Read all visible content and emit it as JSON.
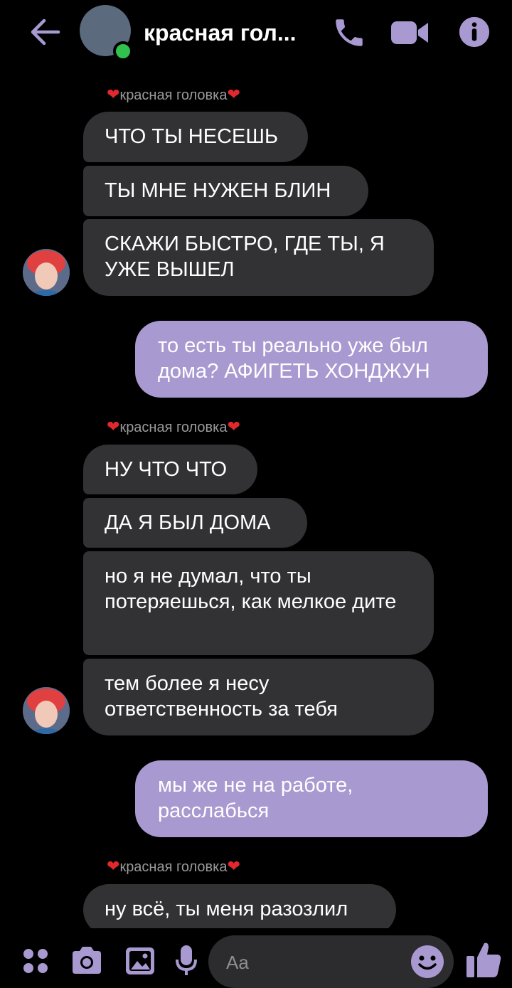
{
  "header": {
    "title": "красная гол...",
    "colors": {
      "accent": "#a899d0",
      "online": "#31c24d"
    }
  },
  "messages": [
    {
      "sender": "красная головка"
    },
    {
      "text": "ЧТО ТЫ НЕСЕШЬ"
    },
    {
      "text": "ТЫ МНЕ НУЖЕН БЛИН"
    },
    {
      "text": "СКАЖИ БЫСТРО, ГДЕ ТЫ, Я УЖЕ ВЫШЕЛ"
    },
    {
      "text": "то есть ты реально уже был дома? АФИГЕТЬ ХОНДЖУН"
    },
    {
      "sender": "красная головка"
    },
    {
      "text": "НУ ЧТО ЧТО"
    },
    {
      "text": "ДА Я БЫЛ ДОМА"
    },
    {
      "text": "но я не думал, что ты потеряешься, как мелкое дите"
    },
    {
      "text": "тем более я несу ответственность за тебя"
    },
    {
      "text": "мы же не на работе, расслабься"
    },
    {
      "sender": "красная головка"
    },
    {
      "text": "ну всё, ты меня разозлил"
    }
  ],
  "composer": {
    "placeholder": "Aa"
  }
}
